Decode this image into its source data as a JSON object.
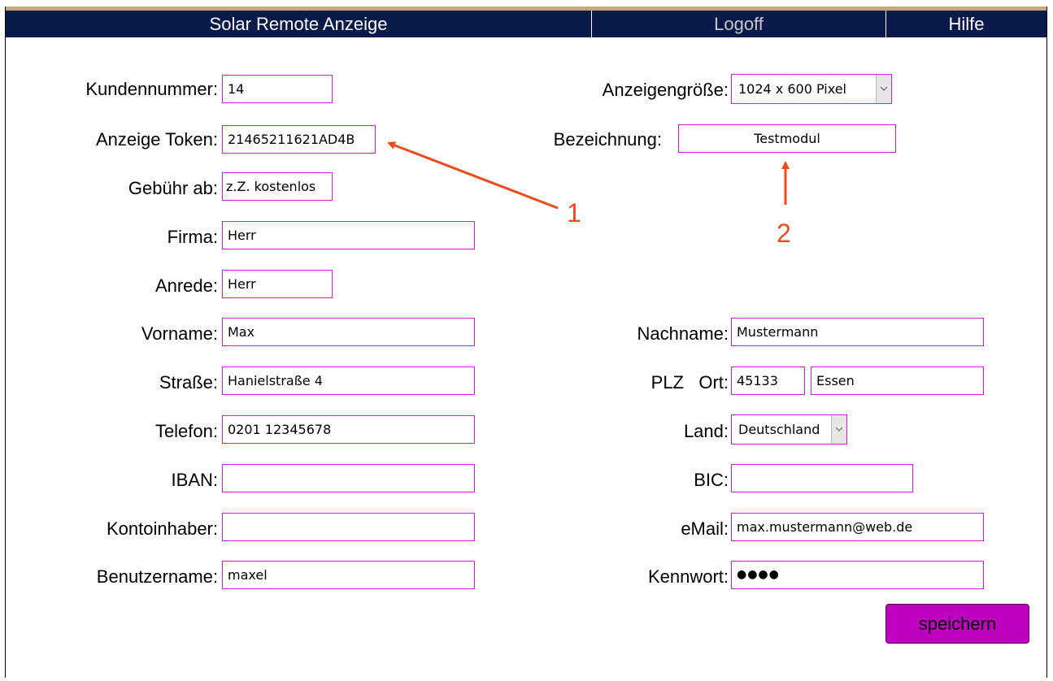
{
  "header": {
    "title": "Solar Remote Anzeige",
    "logoff": "Logoff",
    "help": "Hilfe"
  },
  "form": {
    "kundennummer": {
      "label": "Kundennummer:",
      "value": "14"
    },
    "token": {
      "label": "Anzeige Token:",
      "value": "21465211621AD4B"
    },
    "gebuehr": {
      "label": "Gebühr ab:",
      "value": "z.Z. kostenlos"
    },
    "firma": {
      "label": "Firma:",
      "value": "Herr"
    },
    "anrede": {
      "label": "Anrede:",
      "value": "Herr"
    },
    "vorname": {
      "label": "Vorname:",
      "value": "Max"
    },
    "strasse": {
      "label": "Straße:",
      "value": "Hanielstraße 4"
    },
    "telefon": {
      "label": "Telefon:",
      "value": "0201 12345678"
    },
    "iban": {
      "label": "IBAN:",
      "value": ""
    },
    "kontoinhaber": {
      "label": "Kontoinhaber:",
      "value": ""
    },
    "benutzername": {
      "label": "Benutzername:",
      "value": "maxel"
    },
    "anzeigengroesse": {
      "label": "Anzeigengröße:",
      "value": "1024 x 600 Pixel"
    },
    "bezeichnung": {
      "label": "Bezeichnung:",
      "value": "Testmodul"
    },
    "nachname": {
      "label": "Nachname:",
      "value": "Mustermann"
    },
    "plz_ort": {
      "label": "PLZ   Ort:",
      "plz": "45133",
      "ort": "Essen"
    },
    "land": {
      "label": "Land:",
      "value": "Deutschland"
    },
    "bic": {
      "label": "BIC:",
      "value": ""
    },
    "email": {
      "label": "eMail:",
      "value": "max.mustermann@web.de"
    },
    "kennwort": {
      "label": "Kennwort:",
      "value": "●●●●"
    }
  },
  "save_label": "speichern",
  "annotations": {
    "one": "1",
    "two": "2",
    "color": "#ec4c1c"
  },
  "colors": {
    "header_bg": "#0a1a4a",
    "field_border": "#d01fd0",
    "button_bg": "#c000c0"
  }
}
